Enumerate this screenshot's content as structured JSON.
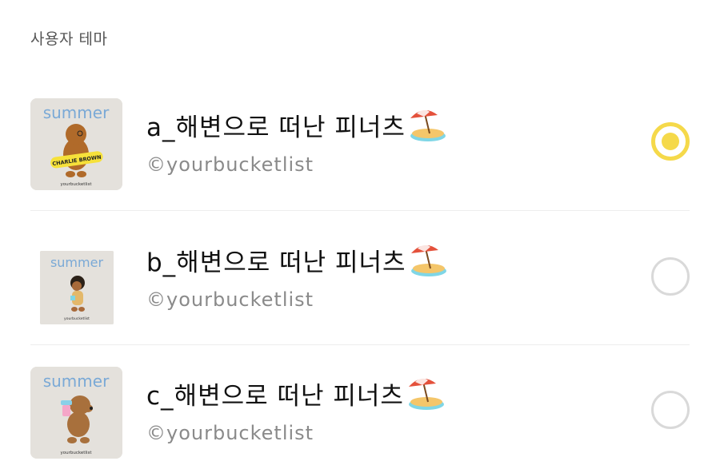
{
  "section": {
    "title": "사용자 테마"
  },
  "themes": [
    {
      "name": "a_해변으로 떠난 피너츠",
      "author": "©yourbucketlist",
      "thumb_title": "summer",
      "thumb_badge": "CHARLIE BROWN",
      "thumb_footer": "yourbucketlist",
      "selected": true
    },
    {
      "name": "b_해변으로 떠난 피너츠",
      "author": "©yourbucketlist",
      "thumb_title": "summer",
      "thumb_footer": "yourbucketlist",
      "selected": false
    },
    {
      "name": "c_해변으로 떠난 피너츠",
      "author": "©yourbucketlist",
      "thumb_title": "summer",
      "thumb_footer": "yourbucketlist",
      "selected": false
    }
  ],
  "colors": {
    "accent": "#f5d94a",
    "thumb_bg": "#e4e1dc",
    "summer_text": "#7aa9d6",
    "divider": "#ededed"
  },
  "icons": [
    "beach-umbrella-emoji",
    "radio-selected-icon",
    "radio-unselected-icon"
  ]
}
